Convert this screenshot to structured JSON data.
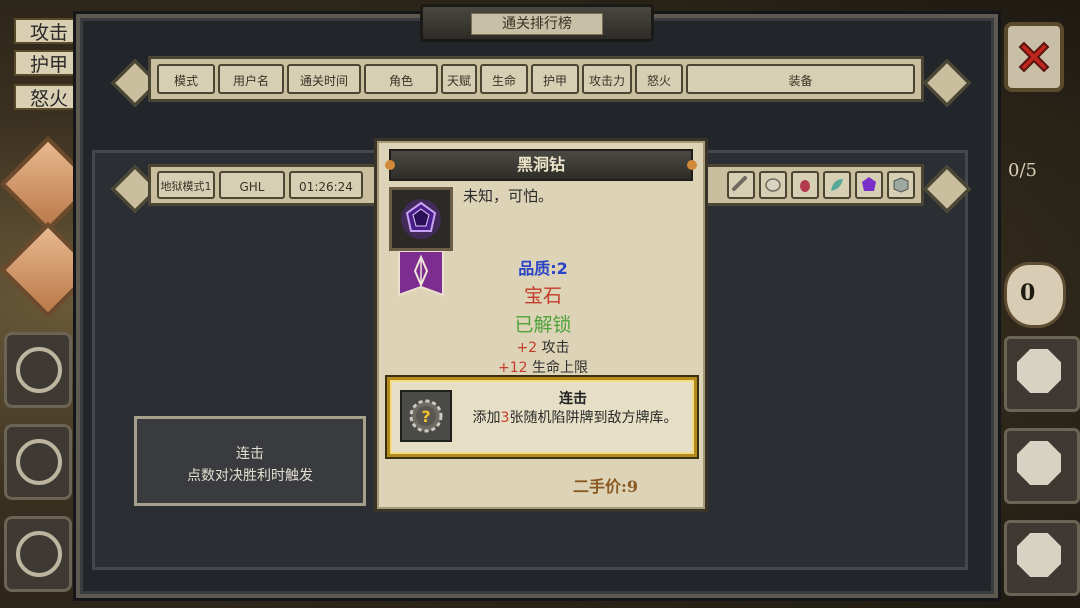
{
  "side": {
    "attack_label": "攻击",
    "armor_label": "护甲",
    "rage_label": "怒火"
  },
  "panel": {
    "title": "通关排行榜",
    "columns": [
      "模式",
      "用户名",
      "通关时间",
      "角色",
      "天赋",
      "生命",
      "护甲",
      "攻击力",
      "怒火",
      "装备"
    ]
  },
  "row": {
    "mode": "地狱模式1",
    "user": "GHL",
    "time": "01:26:24",
    "equipment_icons": [
      "bone-icon",
      "egg-icon",
      "beetle-icon",
      "leaf-icon",
      "purple-gem-icon",
      "cube-icon"
    ]
  },
  "hud": {
    "progress": "0/5",
    "bag_count": "0"
  },
  "tooltip_left": {
    "name": "连击",
    "desc": "点数对决胜利时触发"
  },
  "card": {
    "title": "黑洞钻",
    "description": "未知，可怕。",
    "quality": "品质:2",
    "category": "宝石",
    "unlock_status": "已解锁",
    "stat1_value": "+2",
    "stat1_label": "攻击",
    "stat2_value": "+12",
    "stat2_label": "生命上限",
    "skill_name": "连击",
    "skill_desc_pre": "添加",
    "skill_desc_num": "3",
    "skill_desc_post": "张随机陷阱牌到敌方牌库。",
    "price": "二手价:9"
  },
  "colors": {
    "quality": "#2a44c8",
    "category": "#c33b2a",
    "unlock": "#4fa23a",
    "close": "#c0261c"
  }
}
